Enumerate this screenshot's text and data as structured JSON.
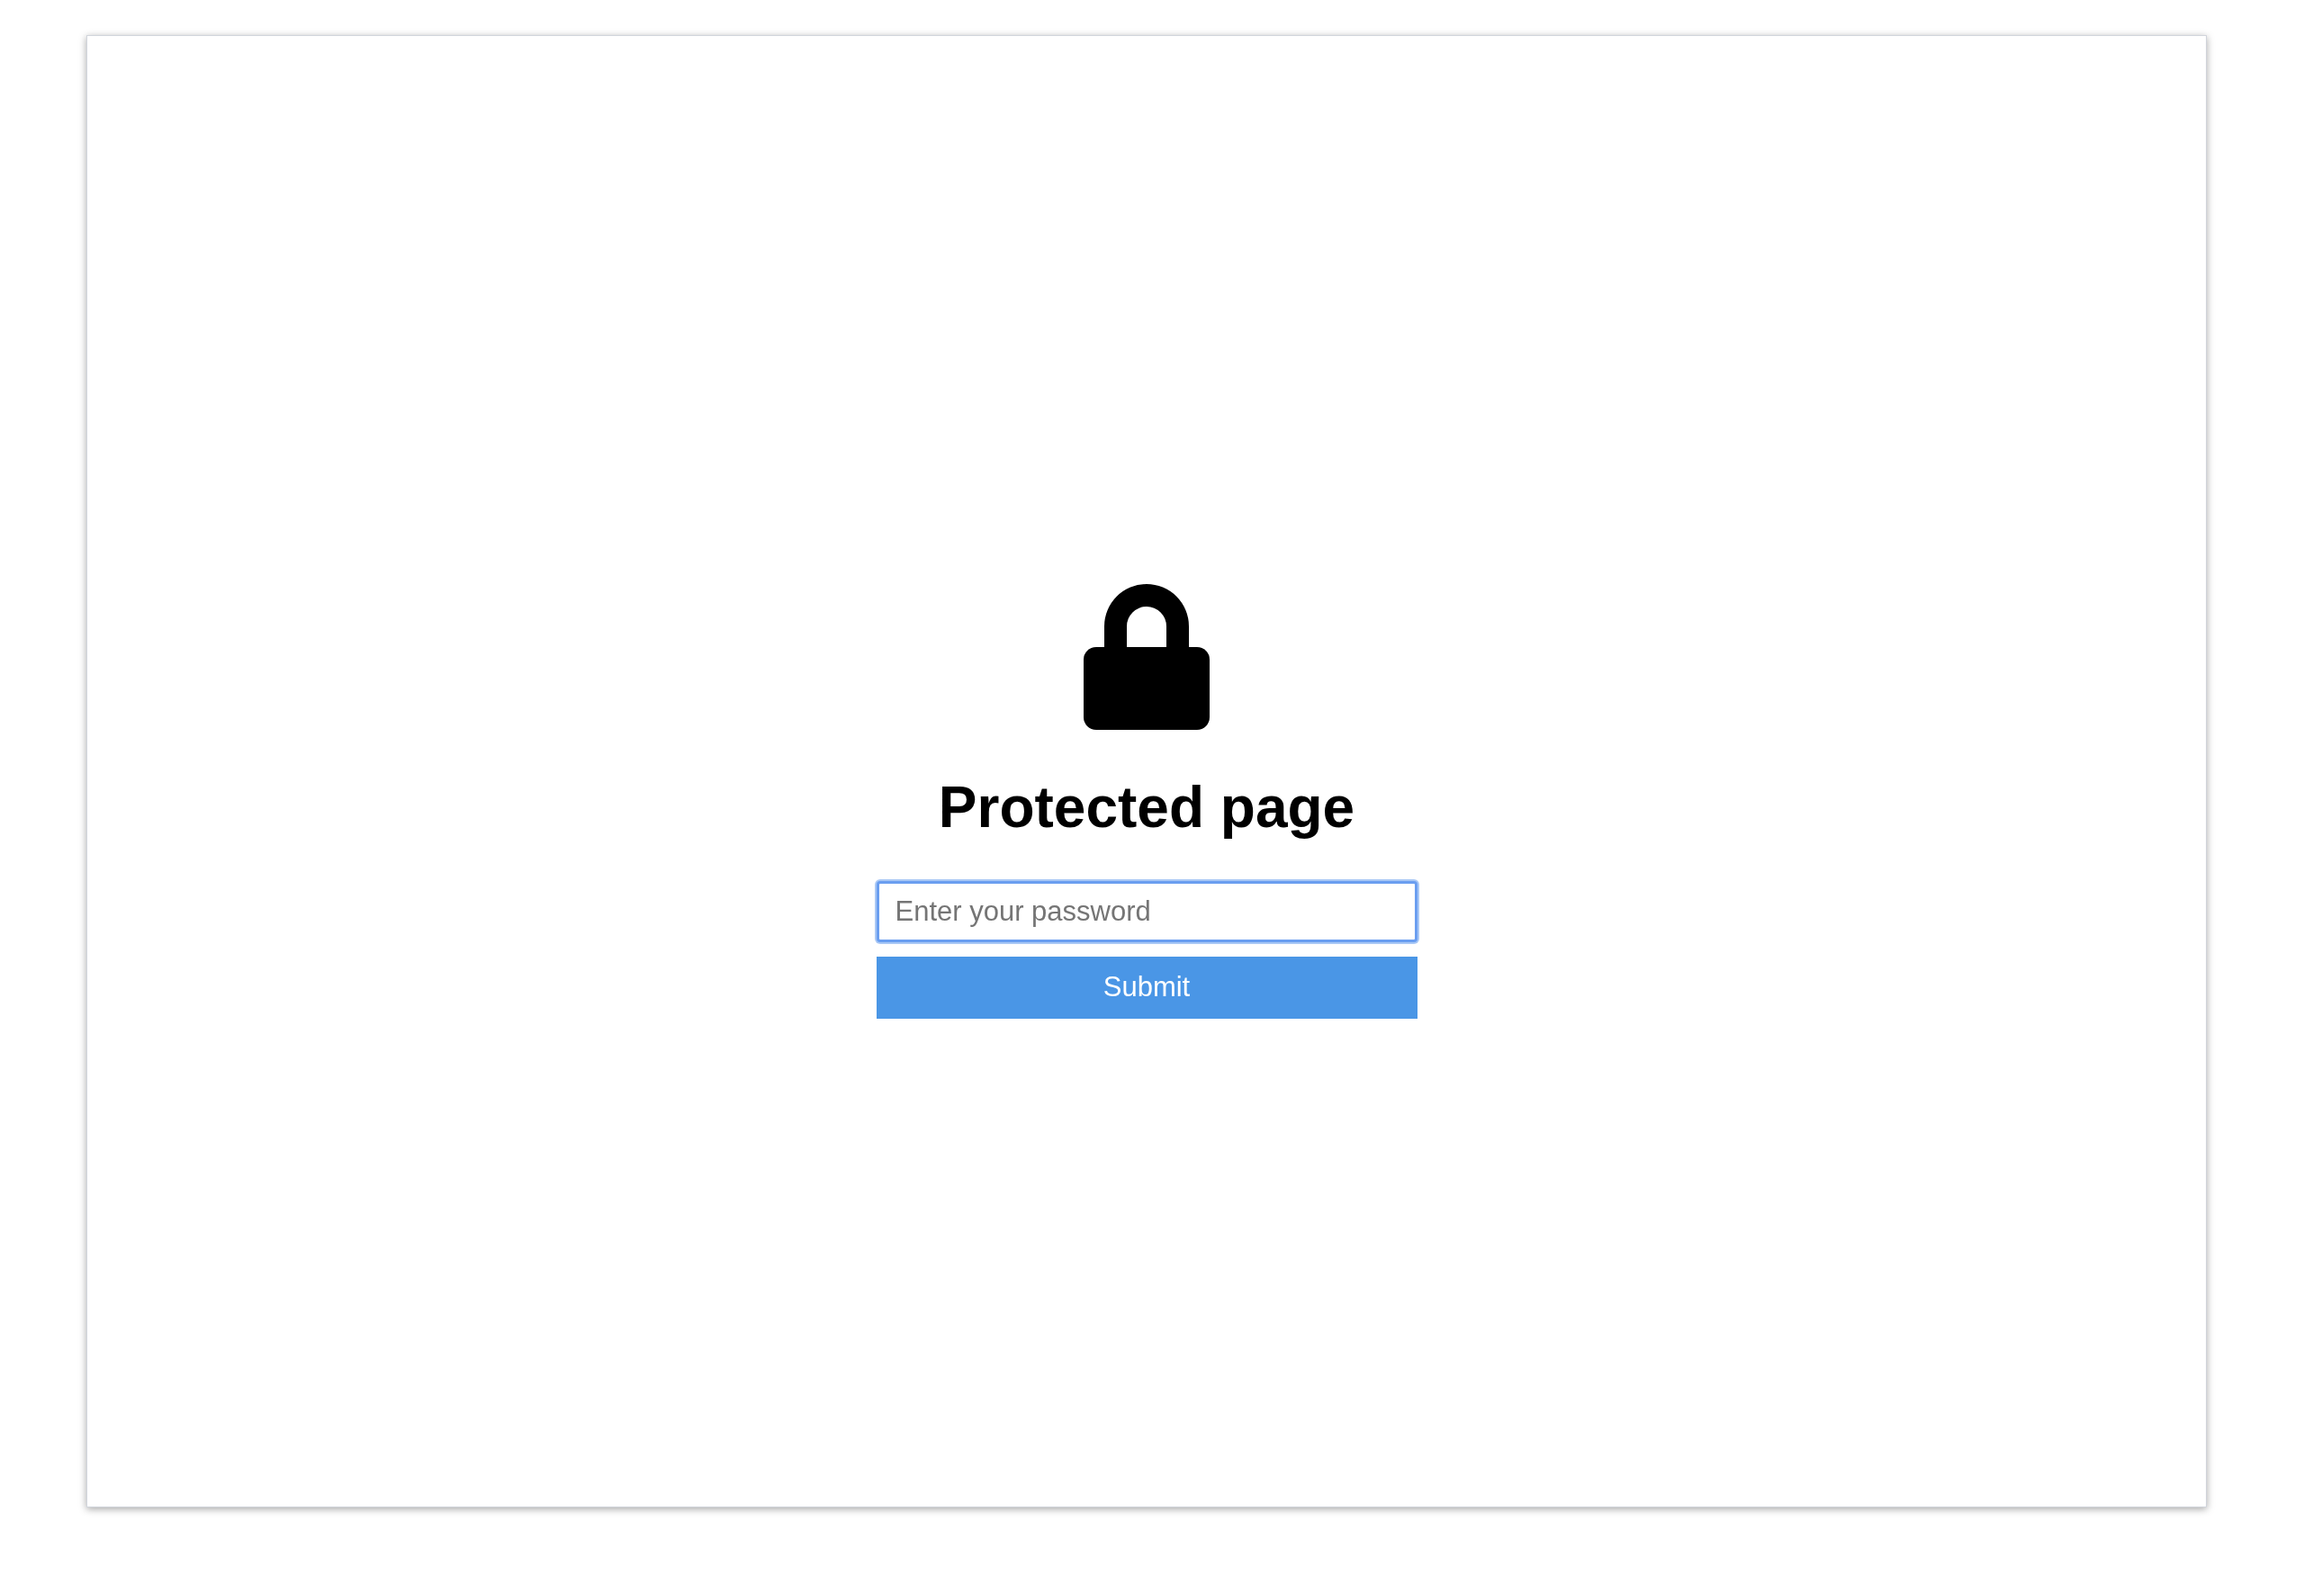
{
  "title": "Protected page",
  "password_field": {
    "placeholder": "Enter your password",
    "focused": true
  },
  "submit_button": {
    "label": "Submit"
  }
}
